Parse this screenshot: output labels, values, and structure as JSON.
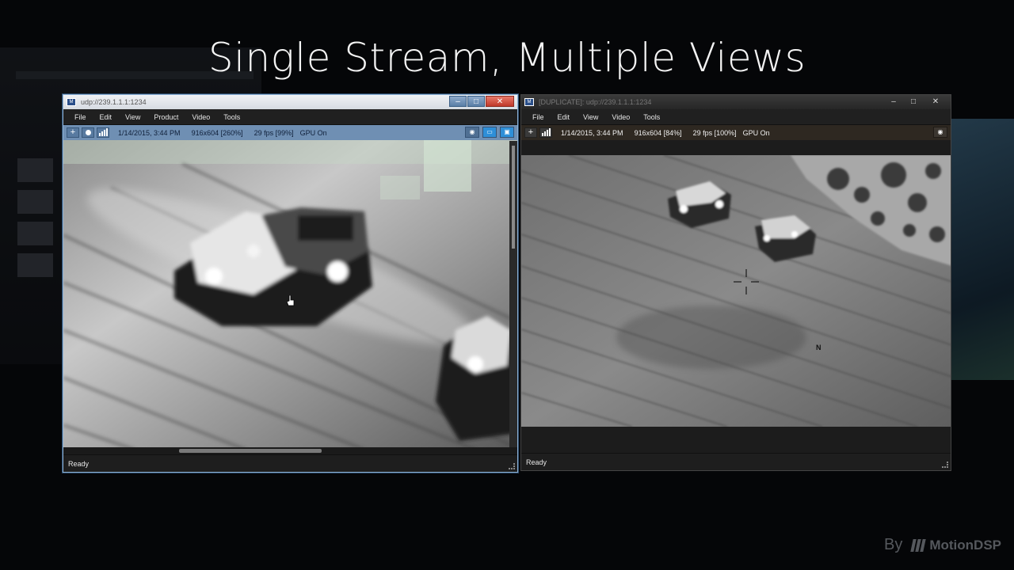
{
  "slide": {
    "title": "Single Stream, Multiple Views",
    "credit_by": "By",
    "credit_brand": "MotionDSP"
  },
  "window_left": {
    "title": "udp://239.1.1.1:1234",
    "controls": [
      "–",
      "□",
      "✕"
    ],
    "menu": [
      "File",
      "Edit",
      "View",
      "Product",
      "Video",
      "Tools"
    ],
    "info": {
      "add_label": "+",
      "datetime": "1/14/2015, 3:44 PM",
      "resolution": "916x604 [260%]",
      "fps": "29 fps [99%]",
      "gpu": "GPU On"
    },
    "status": "Ready",
    "active": true
  },
  "window_right": {
    "title": "[DUPLICATE]: udp://239.1.1.1:1234",
    "controls": [
      "–",
      "□",
      "✕"
    ],
    "menu": [
      "File",
      "Edit",
      "View",
      "Video",
      "Tools"
    ],
    "info": {
      "add_label": "+",
      "datetime": "1/14/2015, 3:44 PM",
      "resolution": "916x604 [84%]",
      "fps": "29 fps [100%]",
      "gpu": "GPU On"
    },
    "overlay_north": "N",
    "status": "Ready",
    "active": false
  },
  "colors": {
    "active_frame": "#8fb2d6",
    "infobar_active": "#6f8fb3",
    "infobar_inactive": "#2e2821",
    "close_button": "#c0392b"
  },
  "icons": {
    "app": "video-app-icon",
    "record": "record-icon",
    "signal": "signal-bars-icon",
    "camera": "camera-icon",
    "split": "split-view-icon",
    "info": "info-icon"
  }
}
